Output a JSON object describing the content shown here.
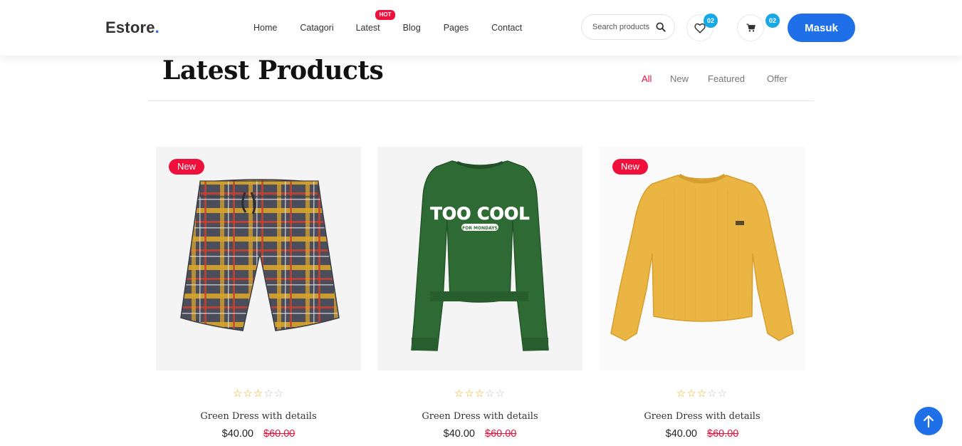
{
  "header": {
    "logo": "Estore",
    "logo_dot": ".",
    "nav": [
      "Home",
      "Catagori",
      "Latest",
      "Blog",
      "Pages",
      "Contact"
    ],
    "hot_badge": "HOT",
    "search_placeholder": "Search products",
    "wishlist_count": "02",
    "cart_count": "02",
    "login_label": "Masuk"
  },
  "section": {
    "title": "Latest Products",
    "filters": [
      "All",
      "New",
      "Featured",
      "Offer"
    ],
    "active_filter": "All"
  },
  "products": [
    {
      "badge": "New",
      "name": "Green Dress with details",
      "price": "$40.00",
      "old_price": "$60.00",
      "rating": 3,
      "image": "plaid-shorts"
    },
    {
      "badge": "",
      "name": "Green Dress with details",
      "price": "$40.00",
      "old_price": "$60.00",
      "rating": 3,
      "image": "green-sweatshirt",
      "print_text": "TOO COOL",
      "print_subtext": "FOR MONDAYS"
    },
    {
      "badge": "New",
      "name": "Green Dress with details",
      "price": "$40.00",
      "old_price": "$60.00",
      "rating": 3,
      "image": "yellow-sweater"
    }
  ],
  "colors": {
    "accent": "#1f6fe8",
    "sale": "#e8123c",
    "badge": "#f0103c",
    "star": "#f2b01e",
    "count_badge": "#19a8e6"
  },
  "icons": [
    "search-icon",
    "heart-icon",
    "cart-icon",
    "arrow-up-icon"
  ]
}
